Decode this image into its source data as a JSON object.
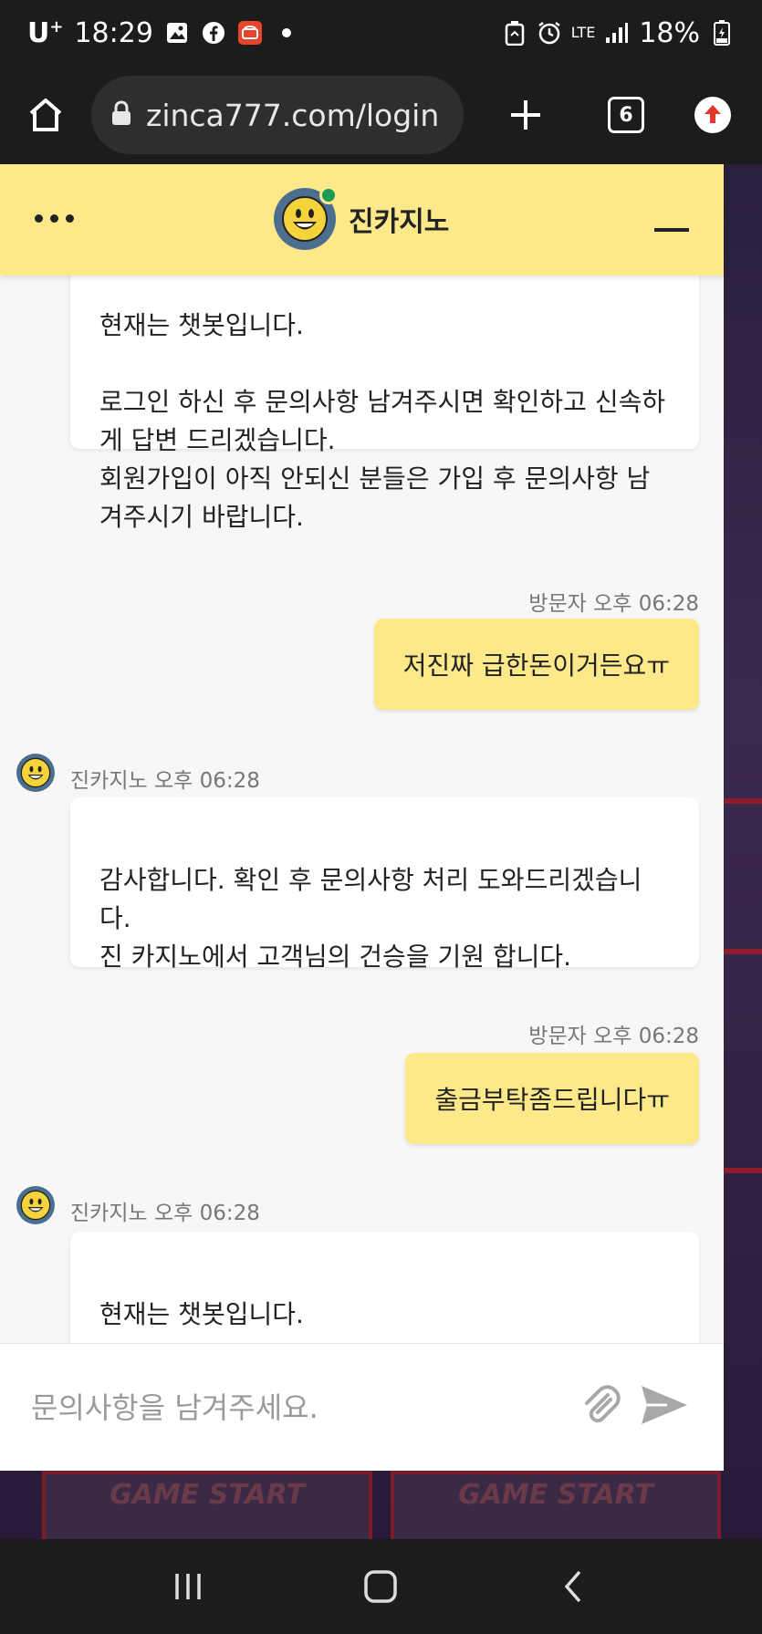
{
  "status_bar": {
    "carrier": "U",
    "carrier_sup": "+",
    "time": "18:29",
    "network": "LTE",
    "battery": "18%"
  },
  "browser": {
    "url": "zinca777.com/login",
    "tab_count": "6"
  },
  "chat": {
    "title": "진카지노",
    "composer_placeholder": "문의사항을 남겨주세요.",
    "messages": [
      {
        "text": "현재는 챗봇입니다.\n\n로그인 하신 후 문의사항 남겨주시면 확인하고 신속하게 답변 드리겠습니다.\n회원가입이 아직 안되신 분들은 가입 후 문의사항 남겨주시기 바랍니다."
      },
      {
        "sender": "방문자",
        "time": "오후 06:28",
        "text": "저진짜 급한돈이거든요ㅠ"
      },
      {
        "sender": "진카지노",
        "time": "오후 06:28",
        "text": "감사합니다. 확인 후 문의사항 처리 도와드리겠습니다.\n진 카지노에서 고객님의 건승을 기원 합니다."
      },
      {
        "sender": "방문자",
        "time": "오후 06:28",
        "text": "출금부탁좀드립니다ㅠ"
      },
      {
        "sender": "진카지노",
        "time": "오후 06:28",
        "text": "현재는 챗봇입니다.\n\n로그인 하신 후 문의사항 남겨주시면 확인하고 신속하게 답변 드리겠습니다."
      }
    ]
  },
  "background": {
    "tile_label": "GAME START"
  },
  "colors": {
    "header_yellow": "#fde98a",
    "online_green": "#1f9a55",
    "avatar_blue": "#4d6f8f",
    "dark_bar": "#1c1c1e"
  },
  "icons": [
    "home-icon",
    "lock-icon",
    "plus-icon",
    "upload-icon",
    "attach-icon",
    "send-icon",
    "recents-icon",
    "home-nav-icon",
    "back-icon"
  ]
}
